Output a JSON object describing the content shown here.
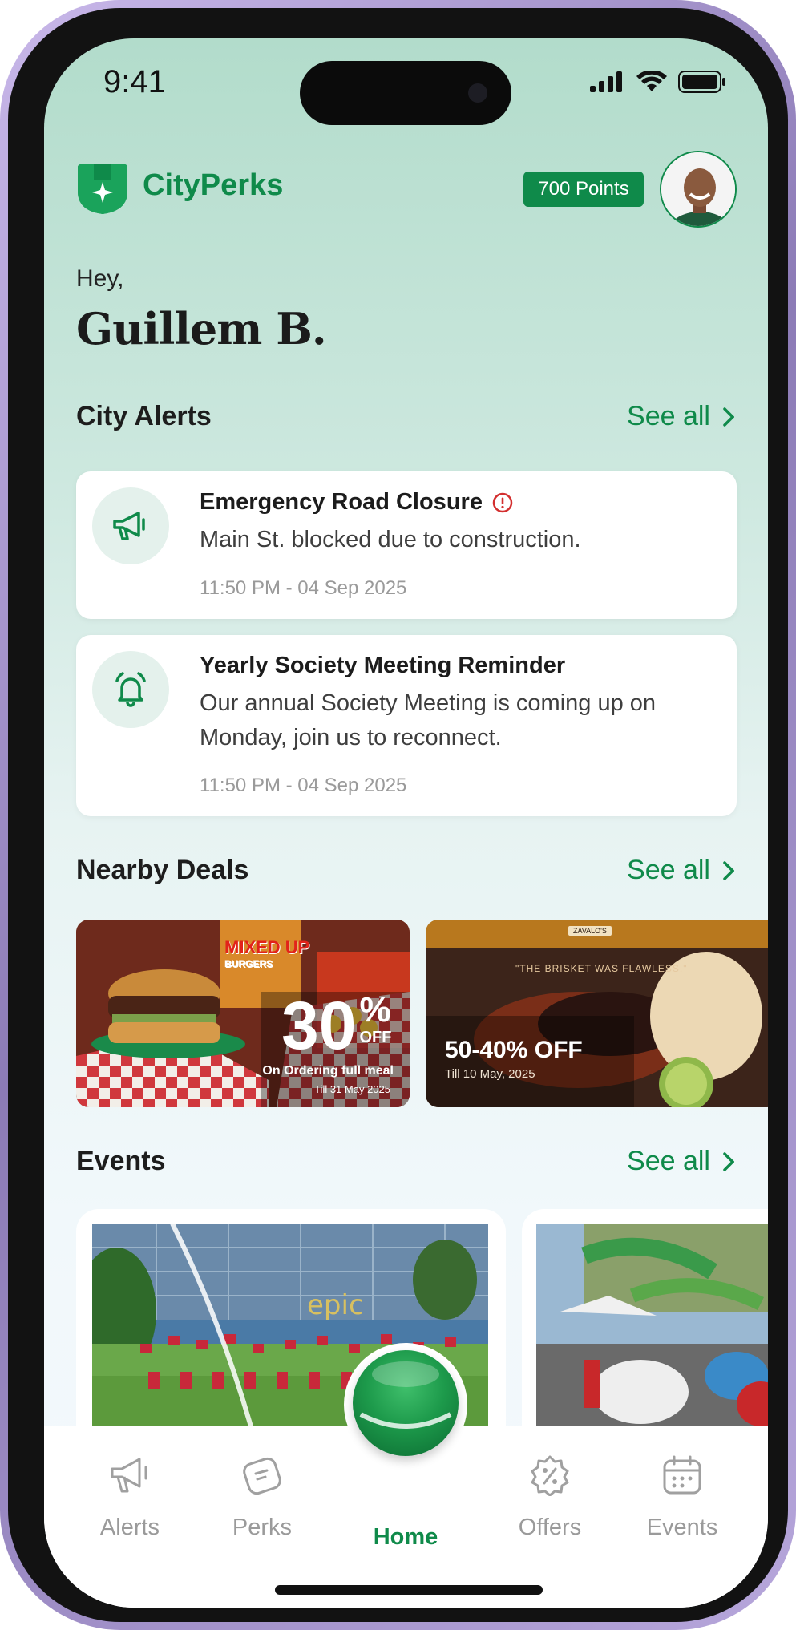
{
  "status": {
    "time": "9:41"
  },
  "header": {
    "brand": "CityPerks",
    "points": "700 Points"
  },
  "greeting": {
    "hey": "Hey,",
    "name": "Guillem B."
  },
  "alerts": {
    "title": "City Alerts",
    "see_all": "See all",
    "items": [
      {
        "title": "Emergency Road Closure",
        "body": "Main St. blocked due to construction.",
        "time": "11:50 PM - 04 Sep 2025",
        "icon": "megaphone-icon",
        "urgent": true
      },
      {
        "title": "Yearly Society Meeting Reminder",
        "body": "Our annual Society Meeting is coming up on Monday, join us to reconnect.",
        "time": "11:50 PM - 04 Sep 2025",
        "icon": "bell-icon",
        "urgent": false
      }
    ]
  },
  "deals": {
    "title": "Nearby Deals",
    "see_all": "See all",
    "items": [
      {
        "brand_text": "MIXED UP",
        "brand_sub": "BURGERS",
        "big": "30",
        "percent": "%",
        "off": "OFF",
        "desc": "On Ordering full meal",
        "till": "Till 31 May 2025"
      },
      {
        "site_name": "ZAVALO'S",
        "quote": "\"THE BRISKET WAS FLAWLESS.\"",
        "headline": "50-40% OFF",
        "till": "Till 10 May, 2025"
      }
    ]
  },
  "events": {
    "title": "Events",
    "see_all": "See all",
    "items": [
      {
        "sign": "epic"
      },
      {
        "sign": ""
      }
    ]
  },
  "nav": {
    "items": [
      {
        "label": "Alerts",
        "icon": "megaphone-icon"
      },
      {
        "label": "Perks",
        "icon": "ticket-icon"
      },
      {
        "label": "Home",
        "icon": "home-orb-icon",
        "active": true
      },
      {
        "label": "Offers",
        "icon": "discount-badge-icon"
      },
      {
        "label": "Events",
        "icon": "calendar-icon"
      }
    ]
  },
  "colors": {
    "brand_green": "#0f8a4a",
    "alert_red": "#d32f2f"
  }
}
